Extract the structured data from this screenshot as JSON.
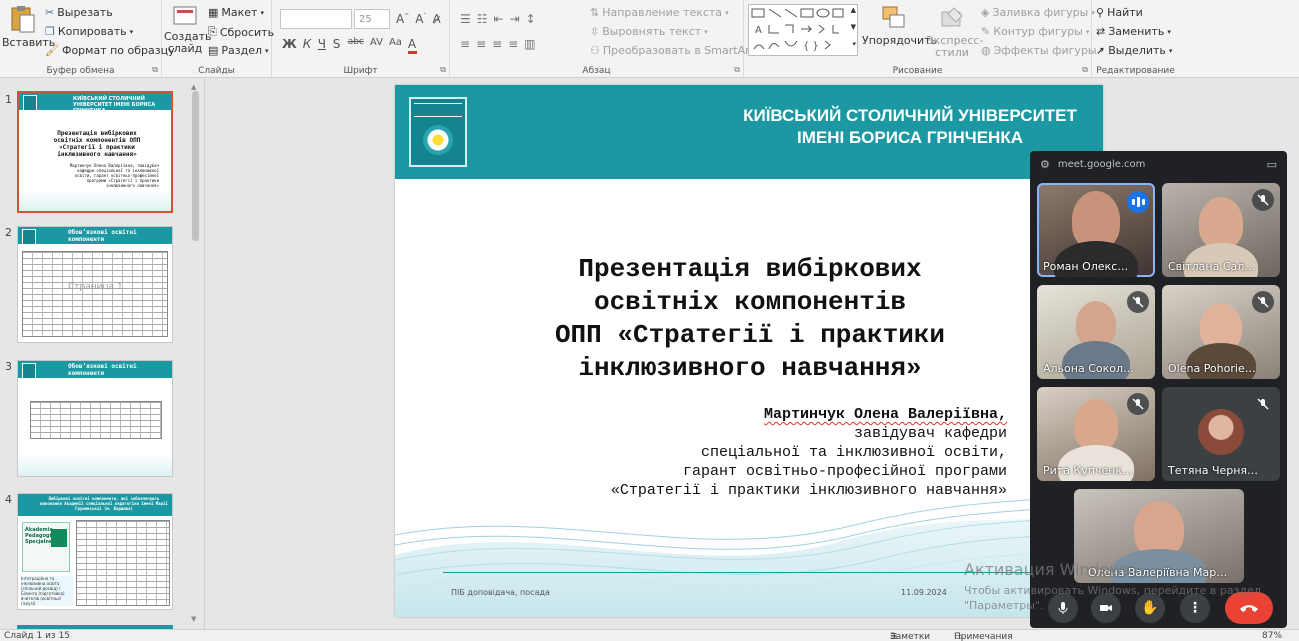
{
  "ribbon": {
    "clipboard": {
      "paste": "Вставить",
      "cut": "Вырезать",
      "copy": "Копировать",
      "format_painter": "Формат по образцу",
      "group": "Буфер обмена"
    },
    "slides": {
      "new_slide_line1": "Создать",
      "new_slide_line2": "слайд",
      "layout": "Макет",
      "reset": "Сбросить",
      "section": "Раздел",
      "group": "Слайды"
    },
    "font": {
      "size": "25",
      "group": "Шрифт",
      "tools": [
        "Ж",
        "К",
        "Ч",
        "S",
        "abc",
        "AV",
        "Aa"
      ]
    },
    "paragraph": {
      "text_direction": "Направление текста",
      "align_text": "Выровнять текст",
      "smartart": "Преобразовать в SmartArt",
      "group": "Абзац"
    },
    "drawing": {
      "arrange": "Упорядочить",
      "styles_line1": "Экспресс-",
      "styles_line2": "стили",
      "fill": "Заливка фигуры",
      "outline": "Контур фигуры",
      "effects": "Эффекты фигуры",
      "group": "Рисование"
    },
    "editing": {
      "find": "Найти",
      "replace": "Заменить",
      "select": "Выделить",
      "group": "Редактирование"
    }
  },
  "thumbnails": [
    {
      "num": "1",
      "title": "Презентація вибіркових освітніх компонентів ОПП «Стратегії і практики інклюзивного навчання»",
      "author": "Мартинчук Олена Валеріївна, завідувач кафедри спеціальної та інклюзивної освіти, гарант освітньо-професійної програми «Стратегії і практики інклюзивного навчання»",
      "head": "КИЇВСЬКИЙ СТОЛИЧНИЙ УНІВЕРСИТЕТ ІМЕНІ БОРИСА ГРІНЧЕНКА"
    },
    {
      "num": "2",
      "title": "Обов’язкові освітні компоненти",
      "watermark": "Страница 1"
    },
    {
      "num": "3",
      "title": "Обов’язкові освітні компоненти"
    },
    {
      "num": "4",
      "title": "Вибіркові освітні компоненти, які забезпечують виконання Академії спеціальної педагогіки імені Марії Грушевської (м. Варшава)",
      "logo_text": "Akademia Pedagogiki Specjalnej",
      "caption": "Інтеграційна та інклюзивна освіта (спільний досвід) / Білинга (підготовка) вчителів (освітньої галузі)"
    }
  ],
  "slide": {
    "university_line1": "КИЇВСЬКИЙ СТОЛИЧНИЙ УНІВЕРСИТЕТ",
    "university_line2": "ІМЕНІ БОРИСА ГРІНЧЕНКА",
    "title_lines": [
      "Презентація вибіркових",
      "освітніх компонентів",
      "ОПП «Стратегії і практики",
      "інклюзивного навчання»"
    ],
    "author_name": "Мартинчук Олена Валеріївна,",
    "author_lines": [
      "завідувач кафедри",
      "спеціальної та інклюзивної освіти,",
      "гарант освітньо-професійної програми",
      "«Стратегії і практики інклюзивного навчання»"
    ],
    "footer_left": "ПІБ доповідача, посада",
    "footer_date": "11.09.2024"
  },
  "meet": {
    "url": "meet.google.com",
    "participants": [
      {
        "name": "Роман Олекс…",
        "speaking": true
      },
      {
        "name": "Світлана Сал…",
        "speaking": false
      },
      {
        "name": "Альона Сокол…",
        "speaking": false
      },
      {
        "name": "Olena Pohorie…",
        "speaking": false
      },
      {
        "name": "Рита Купченк…",
        "speaking": false
      },
      {
        "name": "Тетяна Черня…",
        "speaking": false
      },
      {
        "name": "Олена Валеріївна Мар…",
        "speaking": false
      }
    ],
    "colors": {
      "panel": "#202124",
      "tile": "#3c4043",
      "end": "#ea4335",
      "speak": "#1a73e8"
    }
  },
  "watermark": {
    "title": "Активация Windows",
    "line1": "Чтобы активировать Windows, перейдите в раздел",
    "line2": "\"Параметры\"."
  },
  "status": {
    "slide_counter": "Слайд 1 из 15",
    "notes": "Заметки",
    "comments": "Примечания",
    "zoom": "87%"
  },
  "colors": {
    "accent": "#1b98a2",
    "selection": "#d35230"
  }
}
